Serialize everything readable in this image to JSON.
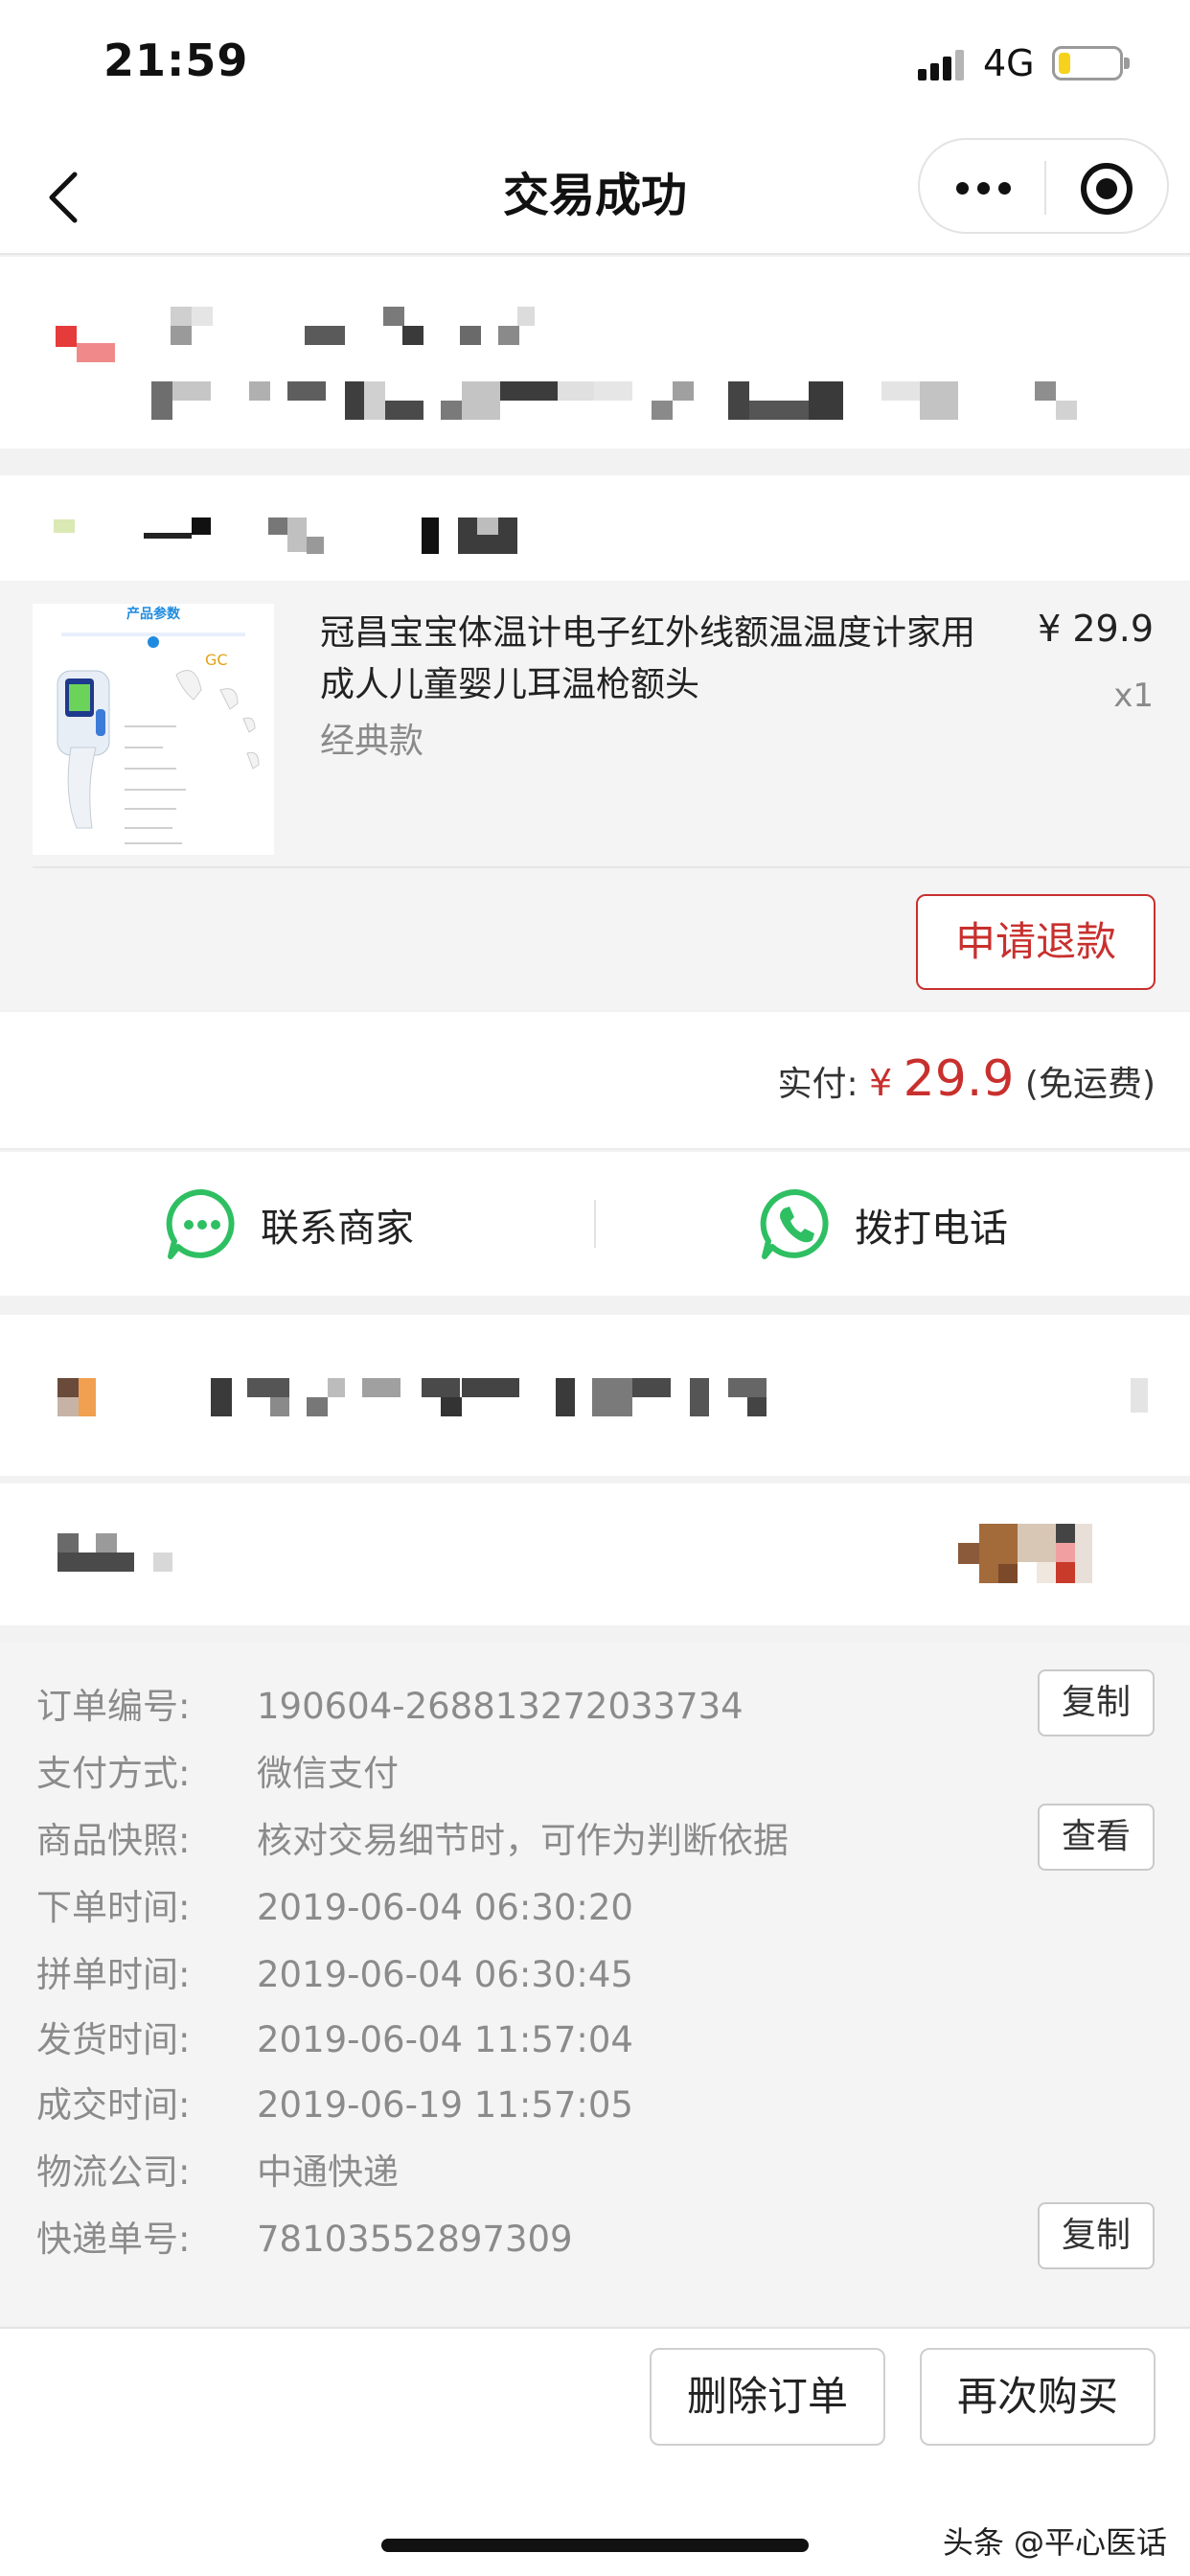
{
  "status_bar": {
    "time": "21:59",
    "network": "4G",
    "battery_level": 0.2
  },
  "nav": {
    "title": "交易成功",
    "colors": {
      "accent": "#c8302e"
    }
  },
  "product": {
    "thumb_header": "产品参数",
    "name": "冠昌宝宝体温计电子红外线额温温度计家用成人儿童婴儿耳温枪额头",
    "spec": "经典款",
    "price": "¥ 29.9",
    "qty": "x1",
    "refund_label": "申请退款"
  },
  "payment": {
    "label": "实付:",
    "currency": "¥",
    "amount": "29.9",
    "shipping": "(免运费)"
  },
  "contact": {
    "merchant_label": "联系商家",
    "call_label": "拨打电话"
  },
  "order": {
    "rows": [
      {
        "label": "订单编号:",
        "value": "190604-268813272033734",
        "button": "复制"
      },
      {
        "label": "支付方式:",
        "value": "微信支付"
      },
      {
        "label": "商品快照:",
        "value": "核对交易细节时，可作为判断依据",
        "button": "查看"
      },
      {
        "label": "下单时间:",
        "value": "2019-06-04 06:30:20"
      },
      {
        "label": "拼单时间:",
        "value": "2019-06-04 06:30:45"
      },
      {
        "label": "发货时间:",
        "value": "2019-06-04 11:57:04"
      },
      {
        "label": "成交时间:",
        "value": "2019-06-19 11:57:05"
      },
      {
        "label": "物流公司:",
        "value": "中通快递"
      },
      {
        "label": "快递单号:",
        "value": "78103552897309",
        "button": "复制"
      }
    ]
  },
  "actions": {
    "delete_label": "删除订单",
    "rebuy_label": "再次购买"
  },
  "watermark": "头条 @平心医话"
}
